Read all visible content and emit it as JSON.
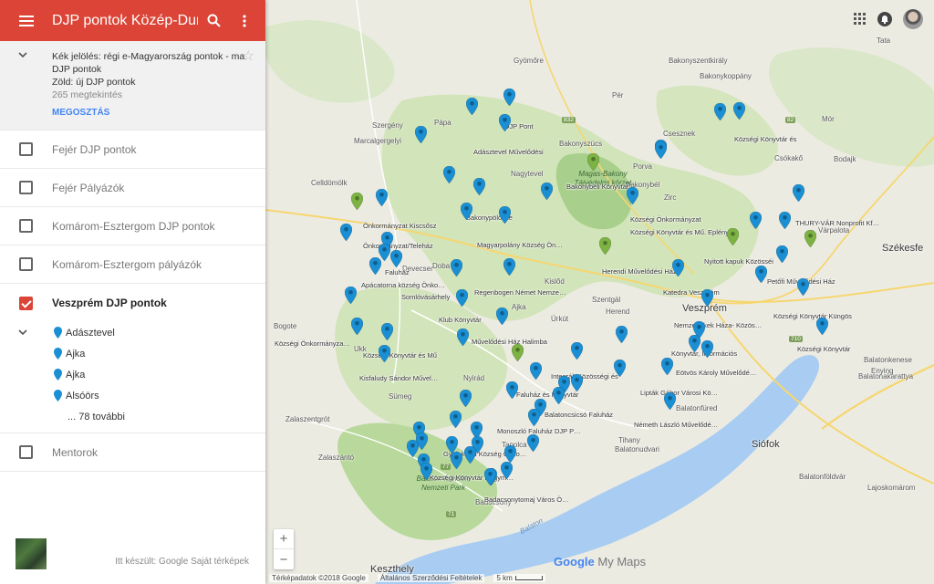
{
  "app": {
    "title": "DJP pontok Közép-Dun…"
  },
  "map_info": {
    "description_line1": "Kék jelölés: régi e-Magyarország pontok - ma",
    "description_line2": "DJP pontok",
    "description_line3": "Zöld: új DJP pontok",
    "views": "265 megtekintés",
    "share_label": "MEGOSZTÁS"
  },
  "layers": [
    {
      "name": "Fejér DJP pontok",
      "checked": false
    },
    {
      "name": "Fejér Pályázók",
      "checked": false
    },
    {
      "name": "Komárom-Esztergom DJP pontok",
      "checked": false
    },
    {
      "name": "Komárom-Esztergom pályázók",
      "checked": false
    },
    {
      "name": "Veszprém DJP pontok",
      "checked": true
    },
    {
      "name": "Mentorok",
      "checked": false
    }
  ],
  "veszprem_items": [
    "Adásztevel",
    "Ajka",
    "Ajka",
    "Alsóörs"
  ],
  "veszprem_more": "... 78 további",
  "footer": {
    "credit": "Itt készült: Google Saját térképek"
  },
  "map": {
    "brand_google": "Google",
    "brand_mymaps": "My Maps",
    "attribution": "Térképadatok ©2018 Google",
    "terms": "Általános Szerződési Feltételek",
    "scale": "5 km",
    "colors": {
      "blue_pin": "#1a8fd4",
      "green_pin": "#7cb342",
      "lake": "#a8ccf2",
      "appbar": "#db4437"
    },
    "places": [
      {
        "name": "Székesfe"
      },
      {
        "name": "Tata"
      },
      {
        "name": "Bakonybél"
      },
      {
        "name": "Zirc"
      },
      {
        "name": "Veszprém"
      },
      {
        "name": "Ajka"
      },
      {
        "name": "Pápa"
      },
      {
        "name": "Tapolca"
      },
      {
        "name": "Sümeg"
      },
      {
        "name": "Keszthely"
      },
      {
        "name": "Siófok"
      },
      {
        "name": "Balatonfüred"
      },
      {
        "name": "Tihany"
      },
      {
        "name": "Várpalota"
      },
      {
        "name": "Devecser"
      },
      {
        "name": "Herend"
      },
      {
        "name": "Nagytevel"
      },
      {
        "name": "Csesznek"
      },
      {
        "name": "Bakonyszentkirály"
      },
      {
        "name": "Mór"
      },
      {
        "name": "Pér"
      },
      {
        "name": "Bakonykoppány"
      },
      {
        "name": "Szentgál"
      },
      {
        "name": "Ukk"
      },
      {
        "name": "Zalaszentgrót"
      },
      {
        "name": "Balatonkenese"
      },
      {
        "name": "Balatonakarattya"
      },
      {
        "name": "Enying"
      },
      {
        "name": "Balatonföldvár"
      },
      {
        "name": "Balatonudvari"
      },
      {
        "name": "Badacsony"
      },
      {
        "name": "Zalaszántó"
      },
      {
        "name": "Kislőd"
      },
      {
        "name": "Nyirád"
      },
      {
        "name": "Doba"
      },
      {
        "name": "Bogote"
      },
      {
        "name": "Szergény"
      },
      {
        "name": "Celldömölk"
      },
      {
        "name": "Marcalgergelyi"
      },
      {
        "name": "Gyömőre"
      },
      {
        "name": "Bakonyszücs"
      },
      {
        "name": "Porva"
      },
      {
        "name": "Bodajk"
      },
      {
        "name": "Csókakő"
      },
      {
        "name": "Úrkút"
      },
      {
        "name": "Lajoskomárom"
      },
      {
        "name": "Balaton"
      }
    ],
    "region_label": "Magas-Bakony Tájvédelmi körzet",
    "region_label2": "Balaton-felvidéki Nemzeti Park",
    "pin_labels": [
      "DJP Pont",
      "Adásztevel Művelődési",
      "Községi Könyvtár és",
      "Bakonybéli Könyvtár",
      "Önkormányzat Kiscsősz",
      "Bakonypölöske",
      "Önkormányzat/Teleház",
      "Magyarpolány Község Ön…",
      "Községi Önkormányzat",
      "Községi Könyvtár és Mű. Eplény",
      "THURY-VÁR Nonprofit Kf…",
      "Nyitott kapuk Közösséi",
      "Faluház",
      "Apácatorna község Önko…",
      "Somlóvásárhely",
      "Regenbogen Német Nemze…",
      "Herendi Művelődési Ház",
      "Katedra Veszprém",
      "Petőfi Művelődési Ház",
      "Klub Könyvtár",
      "Művelődési Ház Halimba",
      "Nemzedékek Háza- Közös…",
      "Községi Könyvtár Küngös",
      "Községi Önkormányza…",
      "Községi Könyvtár és Mű",
      "Könyvtár, Információs",
      "Kisfaludy Sándor Művel…",
      "Integrált Közösségi és",
      "Eötvös Károly Művelődé…",
      "Faluház és Könyvtár",
      "Lipták Gábor Városi Kö…",
      "Balatoncsicsó Faluház",
      "Németh László Művelődé…",
      "Monoszló Faluház DJP P…",
      "Gyulakeszi Község Önko…",
      "Községi Könyvtár Hegym…",
      "Badacsonytomaj Város Ö…",
      "Községi Könyvtár"
    ]
  }
}
